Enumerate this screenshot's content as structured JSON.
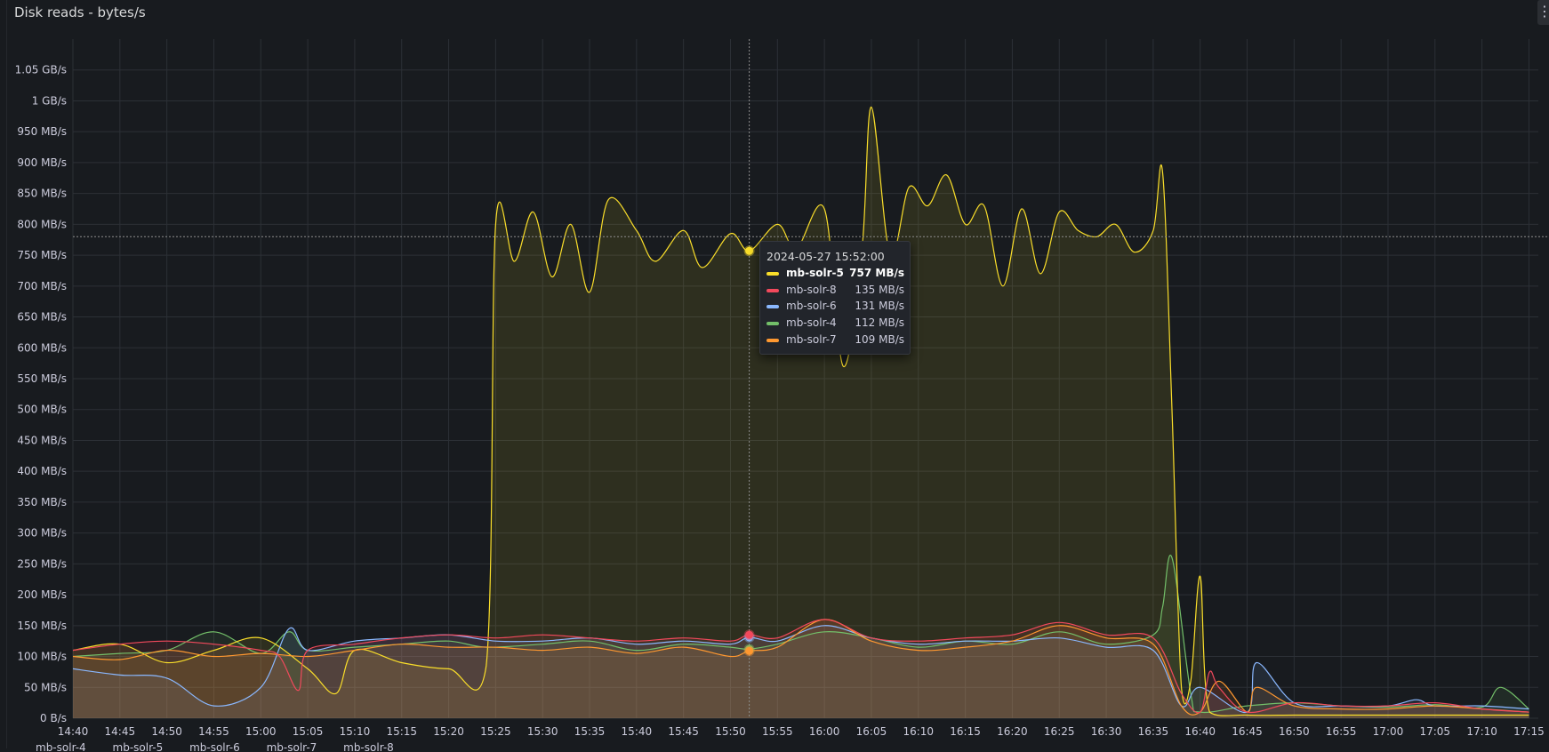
{
  "panel": {
    "title": "Disk reads - bytes/s",
    "menu_icon": "kebab-menu-icon"
  },
  "tooltip": {
    "time": "2024-05-27 15:52:00",
    "rows": [
      {
        "name": "mb-solr-5",
        "value": "757 MB/s",
        "color": "#fade2a",
        "highlight": true
      },
      {
        "name": "mb-solr-8",
        "value": "135 MB/s",
        "color": "#f2495c",
        "highlight": false
      },
      {
        "name": "mb-solr-6",
        "value": "131 MB/s",
        "color": "#8ab8ff",
        "highlight": false
      },
      {
        "name": "mb-solr-4",
        "value": "112 MB/s",
        "color": "#73bf69",
        "highlight": false
      },
      {
        "name": "mb-solr-7",
        "value": "109 MB/s",
        "color": "#ff9830",
        "highlight": false
      }
    ]
  },
  "chart_data": {
    "type": "area",
    "title": "Disk reads - bytes/s",
    "grid": true,
    "legend_placement": "bottom",
    "x_unit": "time",
    "x_ticks": [
      "14:40",
      "14:45",
      "14:50",
      "14:55",
      "15:00",
      "15:05",
      "15:10",
      "15:15",
      "15:20",
      "15:25",
      "15:30",
      "15:35",
      "15:40",
      "15:45",
      "15:50",
      "15:55",
      "16:00",
      "16:05",
      "16:10",
      "16:15",
      "16:20",
      "16:25",
      "16:30",
      "16:35",
      "16:40",
      "16:45",
      "16:50",
      "16:55",
      "17:00",
      "17:05",
      "17:10",
      "17:15"
    ],
    "xlim": [
      "14:40",
      "17:16"
    ],
    "y_unit": "MB/s",
    "ylim": [
      0,
      1100
    ],
    "y_ticks": [
      {
        "v": 0,
        "label": "0 B/s"
      },
      {
        "v": 50,
        "label": "50 MB/s"
      },
      {
        "v": 100,
        "label": "100 MB/s"
      },
      {
        "v": 150,
        "label": "150 MB/s"
      },
      {
        "v": 200,
        "label": "200 MB/s"
      },
      {
        "v": 250,
        "label": "250 MB/s"
      },
      {
        "v": 300,
        "label": "300 MB/s"
      },
      {
        "v": 350,
        "label": "350 MB/s"
      },
      {
        "v": 400,
        "label": "400 MB/s"
      },
      {
        "v": 450,
        "label": "450 MB/s"
      },
      {
        "v": 500,
        "label": "500 MB/s"
      },
      {
        "v": 550,
        "label": "550 MB/s"
      },
      {
        "v": 600,
        "label": "600 MB/s"
      },
      {
        "v": 650,
        "label": "650 MB/s"
      },
      {
        "v": 700,
        "label": "700 MB/s"
      },
      {
        "v": 750,
        "label": "750 MB/s"
      },
      {
        "v": 800,
        "label": "800 MB/s"
      },
      {
        "v": 850,
        "label": "850 MB/s"
      },
      {
        "v": 900,
        "label": "900 MB/s"
      },
      {
        "v": 950,
        "label": "950 MB/s"
      },
      {
        "v": 1000,
        "label": "1 GB/s"
      },
      {
        "v": 1050,
        "label": "1.05 GB/s"
      }
    ],
    "crosshair": {
      "x": "15:52",
      "y": 780
    },
    "series": [
      {
        "name": "mb-solr-4",
        "color": "#73bf69",
        "x": [
          "14:40",
          "14:45",
          "14:50",
          "14:55",
          "15:00",
          "15:03",
          "15:05",
          "15:10",
          "15:15",
          "15:20",
          "15:24",
          "15:30",
          "15:35",
          "15:40",
          "15:45",
          "15:50",
          "15:52",
          "15:55",
          "16:00",
          "16:05",
          "16:10",
          "16:15",
          "16:20",
          "16:25",
          "16:30",
          "16:35",
          "16:36",
          "16:37",
          "16:39",
          "16:40",
          "16:45",
          "16:50",
          "16:55",
          "17:00",
          "17:05",
          "17:10",
          "17:12",
          "17:15"
        ],
        "y": [
          100,
          105,
          110,
          140,
          105,
          140,
          110,
          115,
          120,
          125,
          115,
          120,
          125,
          110,
          120,
          115,
          112,
          120,
          140,
          130,
          115,
          125,
          120,
          140,
          120,
          135,
          180,
          260,
          40,
          10,
          20,
          25,
          20,
          18,
          22,
          18,
          50,
          15
        ]
      },
      {
        "name": "mb-solr-5",
        "color": "#fade2a",
        "x": [
          "14:40",
          "14:45",
          "14:50",
          "14:55",
          "15:00",
          "15:05",
          "15:08",
          "15:10",
          "15:15",
          "15:20",
          "15:24",
          "15:25",
          "15:27",
          "15:29",
          "15:31",
          "15:33",
          "15:35",
          "15:37",
          "15:40",
          "15:42",
          "15:45",
          "15:47",
          "15:50",
          "15:52",
          "15:55",
          "15:57",
          "16:00",
          "16:02",
          "16:04",
          "16:05",
          "16:07",
          "16:09",
          "16:11",
          "16:13",
          "16:15",
          "16:17",
          "16:19",
          "16:21",
          "16:23",
          "16:25",
          "16:27",
          "16:29",
          "16:31",
          "16:33",
          "16:35",
          "16:36",
          "16:37",
          "16:38",
          "16:39",
          "16:40",
          "16:41",
          "16:45",
          "16:50",
          "16:55",
          "17:00",
          "17:05",
          "17:10",
          "17:15"
        ],
        "y": [
          110,
          120,
          90,
          110,
          130,
          80,
          40,
          110,
          90,
          80,
          85,
          800,
          740,
          820,
          715,
          800,
          690,
          840,
          790,
          740,
          790,
          730,
          785,
          757,
          800,
          760,
          825,
          570,
          760,
          990,
          750,
          860,
          830,
          880,
          800,
          830,
          700,
          825,
          720,
          820,
          790,
          780,
          800,
          755,
          790,
          885,
          500,
          50,
          60,
          230,
          10,
          5,
          5,
          5,
          5,
          5,
          5,
          5
        ]
      },
      {
        "name": "mb-solr-6",
        "color": "#8ab8ff",
        "x": [
          "14:40",
          "14:45",
          "14:50",
          "14:55",
          "15:00",
          "15:03",
          "15:05",
          "15:10",
          "15:15",
          "15:20",
          "15:25",
          "15:30",
          "15:35",
          "15:40",
          "15:45",
          "15:50",
          "15:52",
          "15:55",
          "16:00",
          "16:05",
          "16:10",
          "16:15",
          "16:20",
          "16:25",
          "16:30",
          "16:35",
          "16:38",
          "16:40",
          "16:45",
          "16:46",
          "16:50",
          "16:55",
          "17:00",
          "17:03",
          "17:05",
          "17:10",
          "17:15"
        ],
        "y": [
          80,
          70,
          65,
          20,
          50,
          145,
          110,
          125,
          130,
          135,
          125,
          125,
          130,
          120,
          125,
          120,
          131,
          125,
          150,
          130,
          120,
          125,
          125,
          130,
          115,
          110,
          20,
          50,
          10,
          90,
          25,
          20,
          20,
          30,
          20,
          20,
          15
        ]
      },
      {
        "name": "mb-solr-7",
        "color": "#ff9830",
        "x": [
          "14:40",
          "14:45",
          "14:50",
          "14:55",
          "15:00",
          "15:05",
          "15:10",
          "15:15",
          "15:20",
          "15:25",
          "15:30",
          "15:35",
          "15:40",
          "15:45",
          "15:50",
          "15:52",
          "15:55",
          "16:00",
          "16:05",
          "16:10",
          "16:15",
          "16:20",
          "16:25",
          "16:30",
          "16:35",
          "16:38",
          "16:40",
          "16:42",
          "16:45",
          "16:46",
          "16:50",
          "16:55",
          "17:00",
          "17:05",
          "17:10",
          "17:15"
        ],
        "y": [
          100,
          95,
          110,
          100,
          105,
          100,
          110,
          120,
          115,
          115,
          110,
          115,
          105,
          115,
          100,
          109,
          115,
          160,
          125,
          110,
          115,
          125,
          150,
          130,
          120,
          20,
          10,
          60,
          10,
          50,
          20,
          15,
          15,
          20,
          15,
          10
        ]
      },
      {
        "name": "mb-solr-8",
        "color": "#f2495c",
        "x": [
          "14:40",
          "14:45",
          "14:50",
          "14:55",
          "15:00",
          "15:02",
          "15:04",
          "15:05",
          "15:10",
          "15:15",
          "15:20",
          "15:25",
          "15:30",
          "15:35",
          "15:40",
          "15:45",
          "15:50",
          "15:52",
          "15:55",
          "16:00",
          "16:05",
          "16:10",
          "16:15",
          "16:20",
          "16:25",
          "16:30",
          "16:35",
          "16:38",
          "16:40",
          "16:41",
          "16:42",
          "16:45",
          "16:50",
          "16:55",
          "17:00",
          "17:05",
          "17:10",
          "17:15"
        ],
        "y": [
          110,
          120,
          125,
          120,
          110,
          100,
          45,
          110,
          120,
          130,
          135,
          130,
          135,
          130,
          125,
          130,
          125,
          135,
          130,
          160,
          130,
          125,
          130,
          135,
          155,
          135,
          130,
          40,
          10,
          75,
          50,
          10,
          25,
          20,
          20,
          25,
          15,
          10
        ]
      }
    ]
  }
}
